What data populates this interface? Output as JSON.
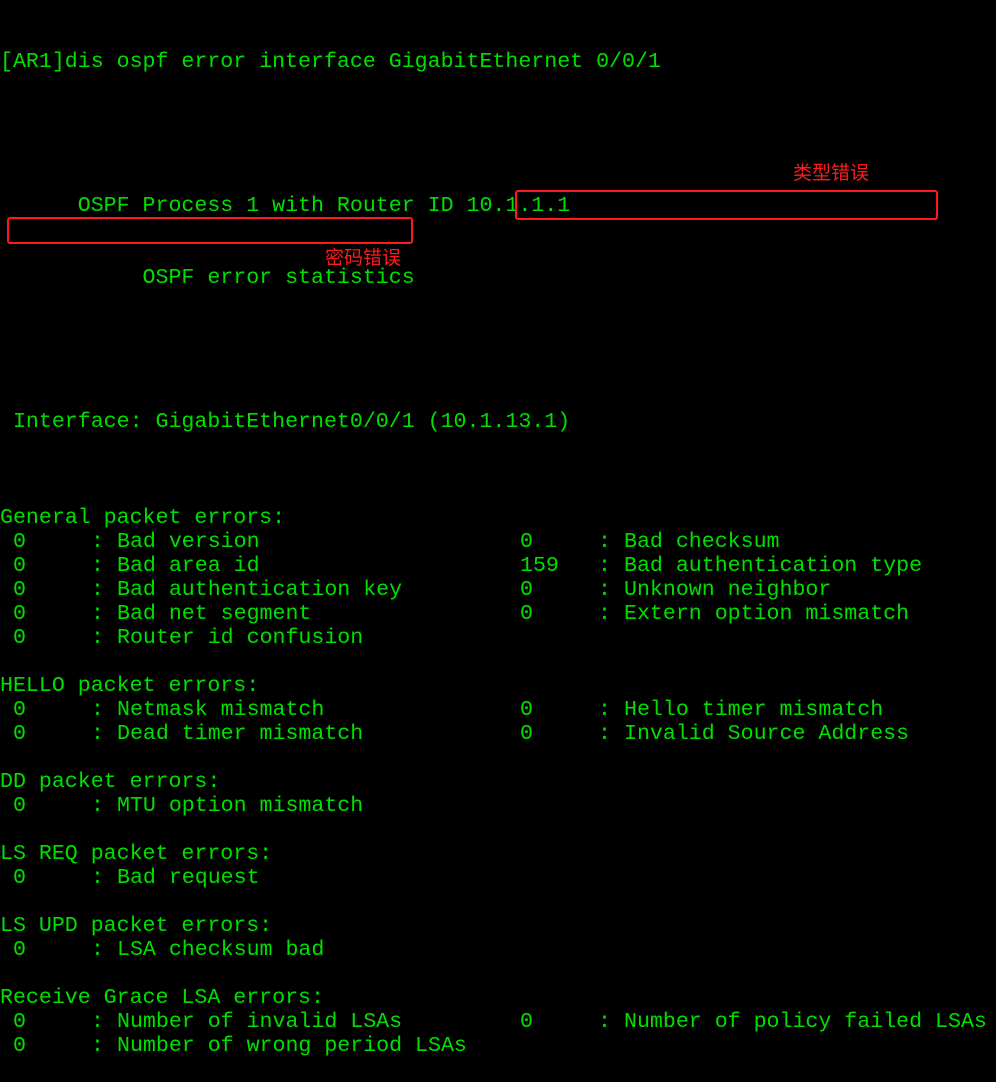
{
  "terminal": {
    "command_line": "[AR1]dis ospf error interface GigabitEthernet 0/0/1",
    "process_header": "      OSPF Process 1 with Router ID 10.1.1.1",
    "stats_header": "           OSPF error statistics",
    "interface_line": " Interface: GigabitEthernet0/0/1 (10.1.13.1)",
    "sections": {
      "general": {
        "title": "General packet errors:",
        "rows": [
          {
            "left_value": "0",
            "left_label": "Bad version",
            "right_value": "0",
            "right_label": "Bad checksum"
          },
          {
            "left_value": "0",
            "left_label": "Bad area id",
            "right_value": "159",
            "right_label": "Bad authentication type"
          },
          {
            "left_value": "0",
            "left_label": "Bad authentication key",
            "right_value": "0",
            "right_label": "Unknown neighbor"
          },
          {
            "left_value": "0",
            "left_label": "Bad net segment",
            "right_value": "0",
            "right_label": "Extern option mismatch"
          },
          {
            "left_value": "0",
            "left_label": "Router id confusion"
          }
        ]
      },
      "hello": {
        "title": "HELLO packet errors:",
        "rows": [
          {
            "left_value": "0",
            "left_label": "Netmask mismatch",
            "right_value": "0",
            "right_label": "Hello timer mismatch"
          },
          {
            "left_value": "0",
            "left_label": "Dead timer mismatch",
            "right_value": "0",
            "right_label": "Invalid Source Address"
          }
        ]
      },
      "dd": {
        "title": "DD packet errors:",
        "rows": [
          {
            "left_value": "0",
            "left_label": "MTU option mismatch"
          }
        ]
      },
      "ls_req": {
        "title": "LS REQ packet errors:",
        "rows": [
          {
            "left_value": "0",
            "left_label": "Bad request"
          }
        ]
      },
      "ls_upd": {
        "title": "LS UPD packet errors:",
        "rows": [
          {
            "left_value": "0",
            "left_label": "LSA checksum bad"
          }
        ]
      },
      "grace": {
        "title": "Receive Grace LSA errors:",
        "rows": [
          {
            "left_value": "0",
            "left_label": "Number of invalid LSAs",
            "right_value": "0",
            "right_label": "Number of policy failed LSAs"
          },
          {
            "left_value": "0",
            "left_label": "Number of wrong period LSAs"
          }
        ]
      }
    },
    "separator": ": "
  },
  "annotations": {
    "type_error_label": "类型错误",
    "key_error_label": "密码错误",
    "highlight_color": "#ff1a1a"
  }
}
